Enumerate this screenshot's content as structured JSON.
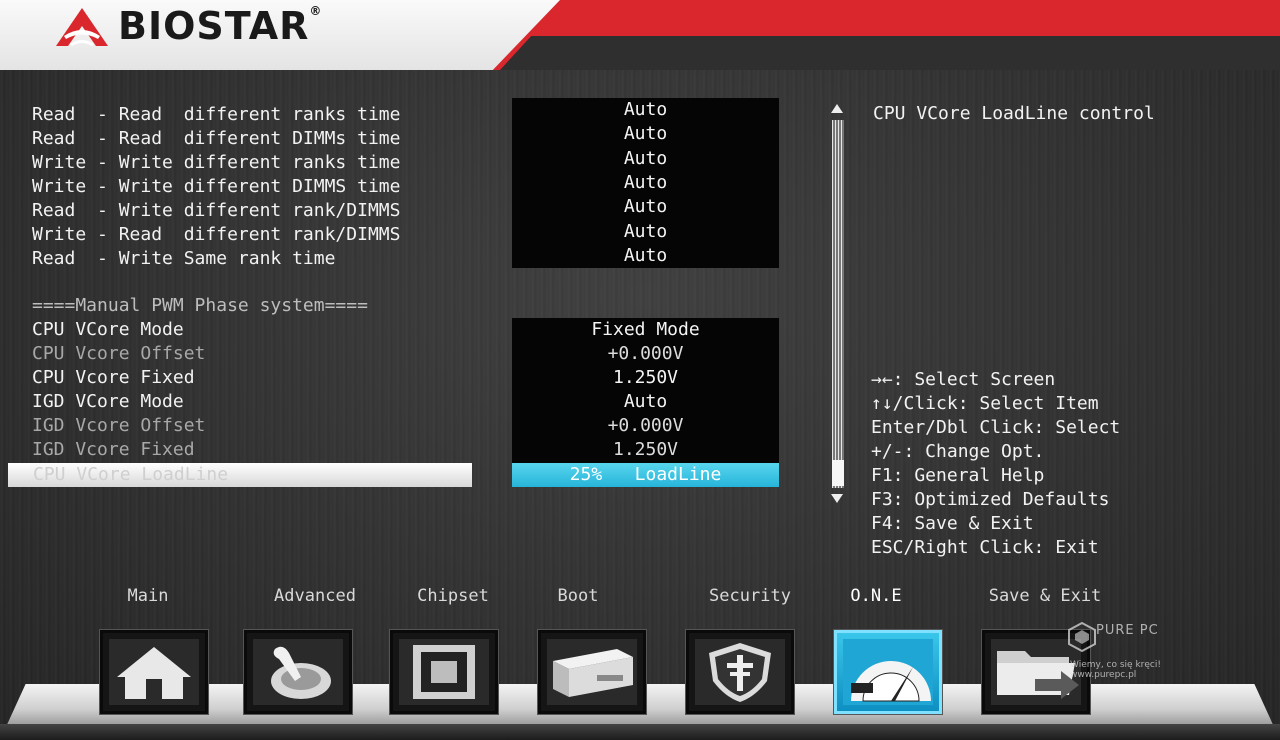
{
  "brand": {
    "name": "BIOSTAR",
    "reg": "®"
  },
  "settings": [
    {
      "label": "Read  - Read  different ranks time",
      "value": "Auto"
    },
    {
      "label": "Read  - Read  different DIMMs time",
      "value": "Auto"
    },
    {
      "label": "Write - Write different ranks time",
      "value": "Auto"
    },
    {
      "label": "Write - Write different DIMMS time",
      "value": "Auto"
    },
    {
      "label": "Read  - Write different rank/DIMMS",
      "value": "Auto"
    },
    {
      "label": "Write - Read  different rank/DIMMS",
      "value": "Auto"
    },
    {
      "label": "Read  - Write Same rank time",
      "value": "Auto"
    }
  ],
  "section_title": "====Manual PWM Phase system====",
  "pwm_settings": [
    {
      "label": "CPU VCore Mode",
      "value": "Fixed Mode"
    },
    {
      "label": "CPU Vcore Offset",
      "value": "+0.000V"
    },
    {
      "label": "CPU Vcore Fixed",
      "value": "1.250V"
    },
    {
      "label": "IGD VCore Mode",
      "value": "Auto"
    },
    {
      "label": "IGD Vcore Offset",
      "value": "+0.000V"
    },
    {
      "label": "IGD Vcore Fixed",
      "value": "1.250V"
    }
  ],
  "selected": {
    "label": "CPU VCore LoadLine",
    "value": "25%   LoadLine"
  },
  "help": {
    "title": "CPU VCore LoadLine control",
    "keys": [
      "→←: Select Screen",
      "↑↓/Click: Select Item",
      "Enter/Dbl Click: Select",
      "+/-: Change Opt.",
      "F1: General Help",
      "F3: Optimized Defaults",
      "F4: Save & Exit",
      "ESC/Right Click: Exit"
    ]
  },
  "nav": [
    {
      "label": "Main",
      "icon": "home-icon"
    },
    {
      "label": "Advanced",
      "icon": "joystick-icon"
    },
    {
      "label": "Chipset",
      "icon": "chip-icon"
    },
    {
      "label": "Boot",
      "icon": "drive-icon"
    },
    {
      "label": "Security",
      "icon": "shield-icon"
    },
    {
      "label": "O.N.E",
      "icon": "speedometer-icon",
      "active": true
    },
    {
      "label": "Save & Exit",
      "icon": "folder-exit-icon"
    }
  ],
  "watermark": {
    "brand": "PURE PC",
    "tagline": "Wiemy, co się kręci!",
    "url": "www.purepc.pl"
  },
  "colors": {
    "brand_red": "#d9272d",
    "highlight_cyan": "#2bb8de",
    "background": "#343434"
  }
}
